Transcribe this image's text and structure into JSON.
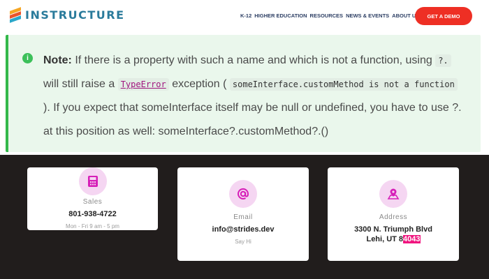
{
  "header": {
    "logo_text": "INSTRUCTURE",
    "nav": [
      "K-12",
      "HIGHER EDUCATION",
      "RESOURCES",
      "NEWS & EVENTS",
      "ABOUT US"
    ],
    "cta_label": "GET A DEMO"
  },
  "note": {
    "icon": "info-icon",
    "label": "Note:",
    "t1": "If there is a property with such a name and which is not a function, using",
    "c1": "?.",
    "t2": "will still raise a",
    "c2": "TypeError",
    "t3": "exception (",
    "c3": "someInterface.customMethod is not a function",
    "t4": "). If you expect that someInterface itself may be null or undefined, you have to use ?. at this position as well: someInterface?.customMethod?.()"
  },
  "cards": [
    {
      "icon": "calculator-icon",
      "label": "Sales",
      "value": "801-938-4722",
      "sub": "Mon - Fri 9 am - 5 pm"
    },
    {
      "icon": "at-sign-icon",
      "label": "Email",
      "value": "info@strides.dev",
      "sub": "Say Hi"
    },
    {
      "icon": "map-pin-icon",
      "label": "Address",
      "value_line1": "3300 N. Triumph Blvd",
      "value_line2_pre": "Lehi, UT 8",
      "value_line2_hl": "4043"
    }
  ],
  "colors": {
    "accent_red": "#ee2f24",
    "note_bg": "#eaf7ec",
    "note_border": "#33b84a",
    "dark_bg": "#211d1c",
    "icon_bg": "#f5d6f2",
    "icon_fg": "#d61fb8",
    "highlight": "#f0157f"
  }
}
